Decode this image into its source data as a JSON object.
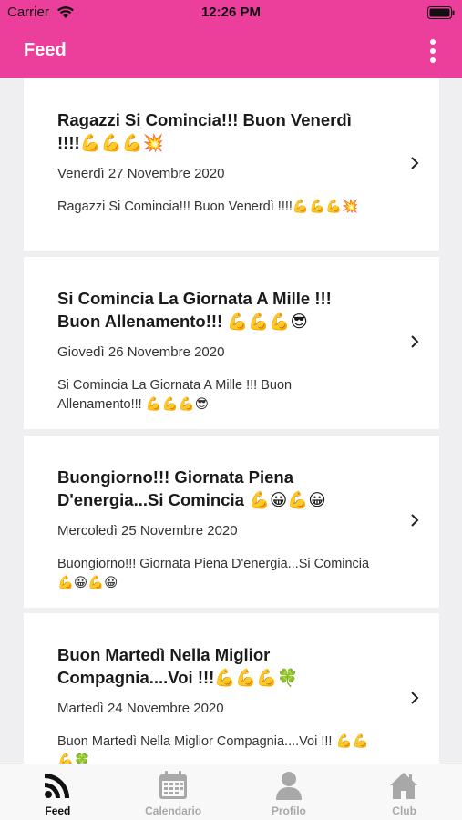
{
  "status_bar": {
    "carrier": "Carrier",
    "time": "12:26 PM"
  },
  "nav": {
    "title": "Feed"
  },
  "feed": [
    {
      "title": "Ragazzi Si Comincia!!! Buon Venerdì !!!!💪💪💪💥",
      "date": "Venerdì 27 Novembre 2020",
      "body": "Ragazzi Si Comincia!!! Buon Venerdì !!!!💪💪💪💥"
    },
    {
      "title": "Si Comincia La Giornata A Mille !!! Buon Allenamento!!! 💪💪💪😎",
      "date": "Giovedì 26 Novembre 2020",
      "body": "Si Comincia La Giornata A Mille !!! Buon Allenamento!!! 💪💪💪😎"
    },
    {
      "title": "Buongiorno!!! Giornata Piena D'energia...Si Comincia 💪😀💪😀",
      "date": "Mercoledì 25 Novembre 2020",
      "body": "Buongiorno!!! Giornata Piena D'energia...Si Comincia 💪😀💪😀"
    },
    {
      "title": "Buon Martedì Nella Miglior Compagnia....Voi !!!💪💪💪🍀",
      "date": "Martedì 24 Novembre 2020",
      "body": "Buon Martedì Nella Miglior Compagnia....Voi !!! 💪💪💪🍀"
    }
  ],
  "tabs": [
    {
      "label": "Feed",
      "icon": "rss-icon",
      "active": true
    },
    {
      "label": "Calendario",
      "icon": "calendar-icon",
      "active": false
    },
    {
      "label": "Profilo",
      "icon": "user-icon",
      "active": false
    },
    {
      "label": "Club",
      "icon": "home-icon",
      "active": false
    }
  ],
  "colors": {
    "accent": "#ec3e9b",
    "tab_active": "#111111",
    "tab_inactive": "#a8a8a8"
  }
}
